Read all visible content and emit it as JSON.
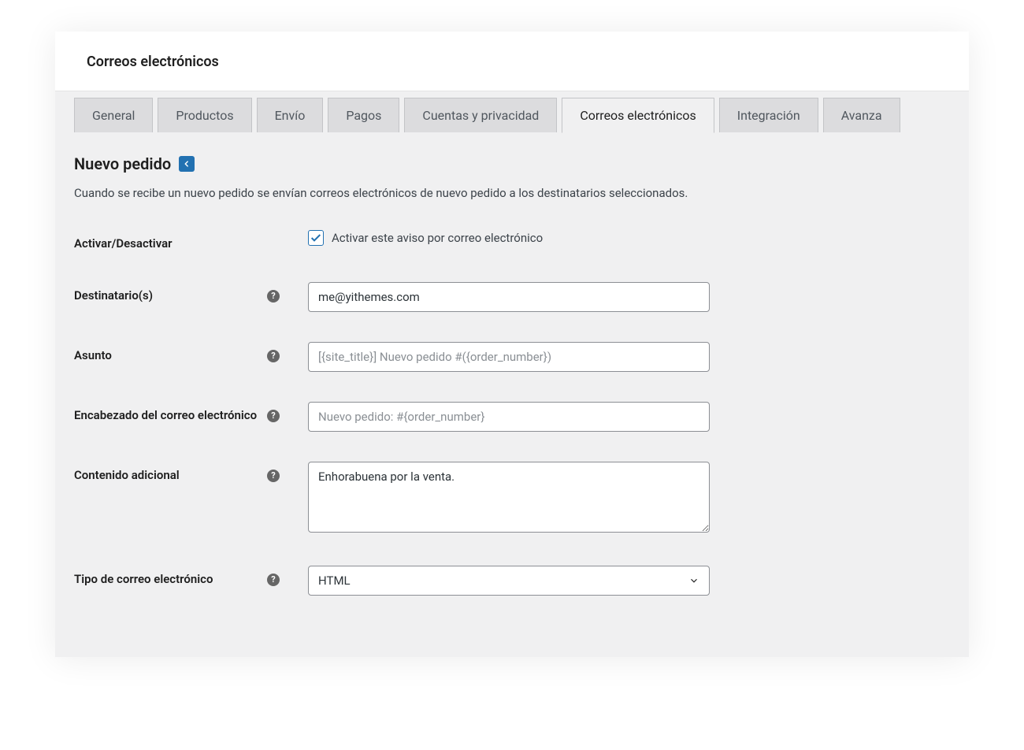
{
  "header": {
    "title": "Correos electrónicos"
  },
  "tabs": [
    {
      "label": "General",
      "active": false
    },
    {
      "label": "Productos",
      "active": false
    },
    {
      "label": "Envío",
      "active": false
    },
    {
      "label": "Pagos",
      "active": false
    },
    {
      "label": "Cuentas y privacidad",
      "active": false
    },
    {
      "label": "Correos electrónicos",
      "active": true
    },
    {
      "label": "Integración",
      "active": false
    },
    {
      "label": "Avanza",
      "active": false
    }
  ],
  "section": {
    "title": "Nuevo pedido",
    "description": "Cuando se recibe un nuevo pedido se envían correos electrónicos de nuevo pedido a los destinatarios seleccionados."
  },
  "form": {
    "enable": {
      "label": "Activar/Desactivar",
      "checkbox_label": "Activar este aviso por correo electrónico",
      "checked": true
    },
    "recipients": {
      "label": "Destinatario(s)",
      "value": "me@yithemes.com"
    },
    "subject": {
      "label": "Asunto",
      "placeholder": "[{site_title}] Nuevo pedido #({order_number})",
      "value": ""
    },
    "heading": {
      "label": "Encabezado del correo electrónico",
      "placeholder": "Nuevo pedido: #{order_number}",
      "value": ""
    },
    "additional": {
      "label": "Contenido adicional",
      "value": "Enhorabuena por la venta."
    },
    "email_type": {
      "label": "Tipo de correo electrónico",
      "value": "HTML"
    }
  }
}
